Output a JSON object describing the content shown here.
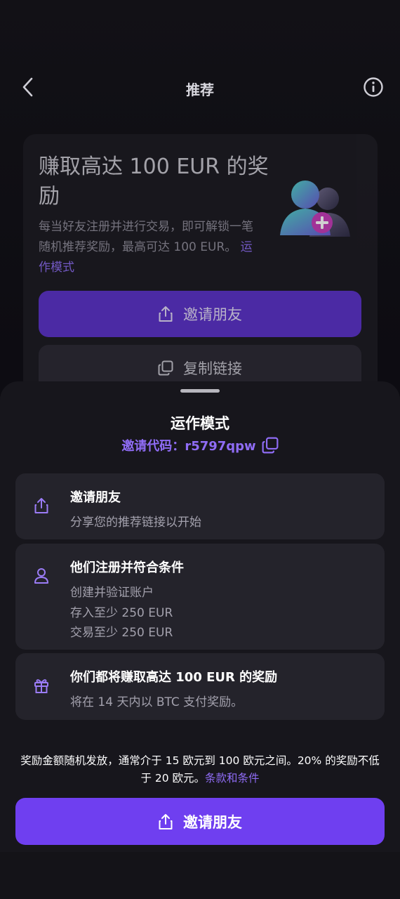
{
  "header": {
    "title": "推荐",
    "back_icon": "chevron-left-icon",
    "info_icon": "info-circle-icon"
  },
  "hero": {
    "title": "赚取高达 100 EUR 的奖励",
    "description": "每当好友注册并进行交易，即可解锁一笔随机推荐奖励，最高可达 100 EUR。",
    "how_it_works_link": "运作模式",
    "invite_button": "邀请朋友",
    "copy_link_button": "复制链接"
  },
  "sheet": {
    "title": "运作模式",
    "invite_code_label": "邀请代码：",
    "invite_code": "r5797qpw",
    "steps": [
      {
        "icon": "share-icon",
        "title": "邀请朋友",
        "lines": [
          "分享您的推荐链接以开始"
        ]
      },
      {
        "icon": "user-icon",
        "title": "他们注册并符合条件",
        "lines": [
          "创建并验证账户",
          "存入至少 250 EUR",
          "交易至少 250 EUR"
        ]
      },
      {
        "icon": "gift-icon",
        "title": "你们都将赚取高达 100 EUR 的奖励",
        "lines": [
          "将在 14 天内以 BTC 支付奖励。"
        ]
      }
    ],
    "footnote": "奖励金额随机发放，通常介于 15 欧元到 100 欧元之间。20% 的奖励不低于 20 欧元。",
    "terms_link": "条款和条件",
    "cta_button": "邀请朋友"
  },
  "colors": {
    "accent": "#6f3ff0",
    "accent_text": "#8f6cf5",
    "sheet_bg": "#17161c",
    "step_bg": "#24232b"
  }
}
